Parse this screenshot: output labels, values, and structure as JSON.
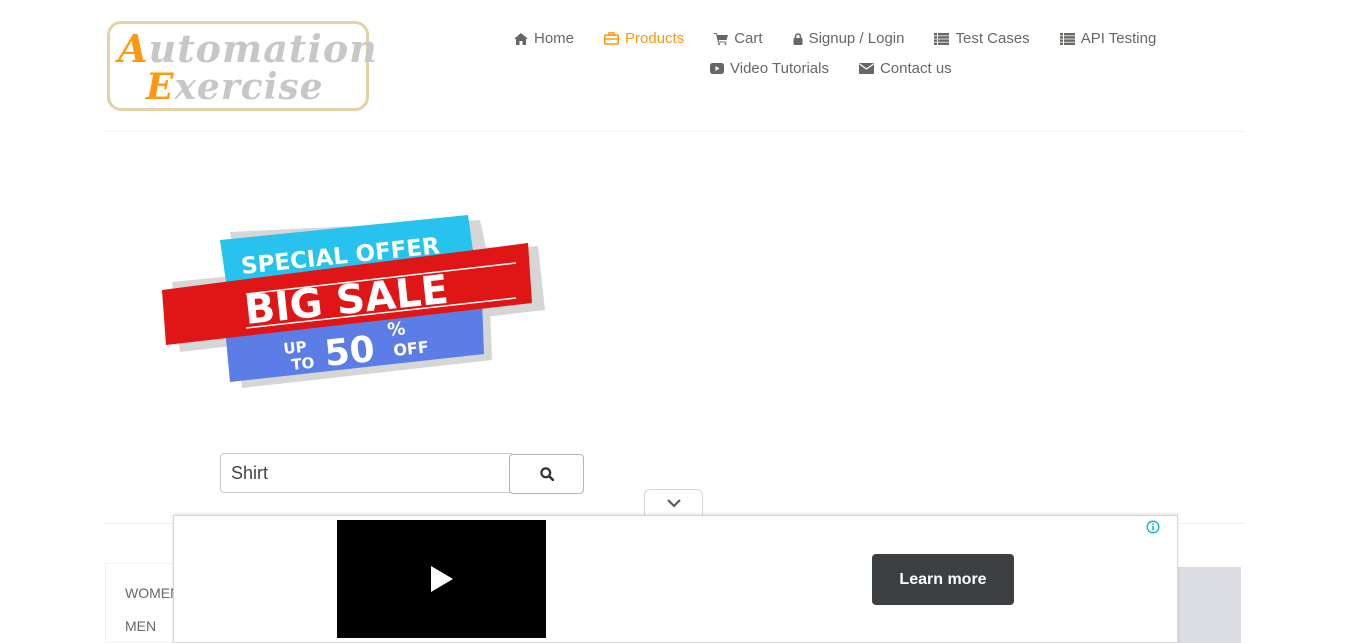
{
  "logo": {
    "line1_cap": "A",
    "line1_rest": "utomation",
    "line2_cap": "E",
    "line2_rest": "xercise"
  },
  "nav": {
    "items": [
      {
        "label": "Home",
        "icon": "home-icon"
      },
      {
        "label": "Products",
        "icon": "products-icon",
        "active": true
      },
      {
        "label": "Cart",
        "icon": "cart-icon"
      },
      {
        "label": "Signup / Login",
        "icon": "lock-icon"
      },
      {
        "label": "Test Cases",
        "icon": "list-icon"
      },
      {
        "label": "API Testing",
        "icon": "list-icon"
      },
      {
        "label": "Video Tutorials",
        "icon": "youtube-play-icon"
      },
      {
        "label": "Contact us",
        "icon": "envelope-icon"
      }
    ]
  },
  "banner": {
    "line1": "SPECIAL OFFER",
    "line2": "BIG SALE",
    "up": "UP",
    "to": "TO",
    "percent": "50",
    "percent_sign": "%",
    "off": "OFF"
  },
  "search": {
    "value": "Shirt"
  },
  "sidebar": {
    "categories": [
      "WOMEN",
      "MEN"
    ]
  },
  "ad": {
    "learn_more": "Learn more"
  },
  "colors": {
    "accent": "#fe980f",
    "text": "#696763",
    "ad_button": "#3c4043"
  }
}
